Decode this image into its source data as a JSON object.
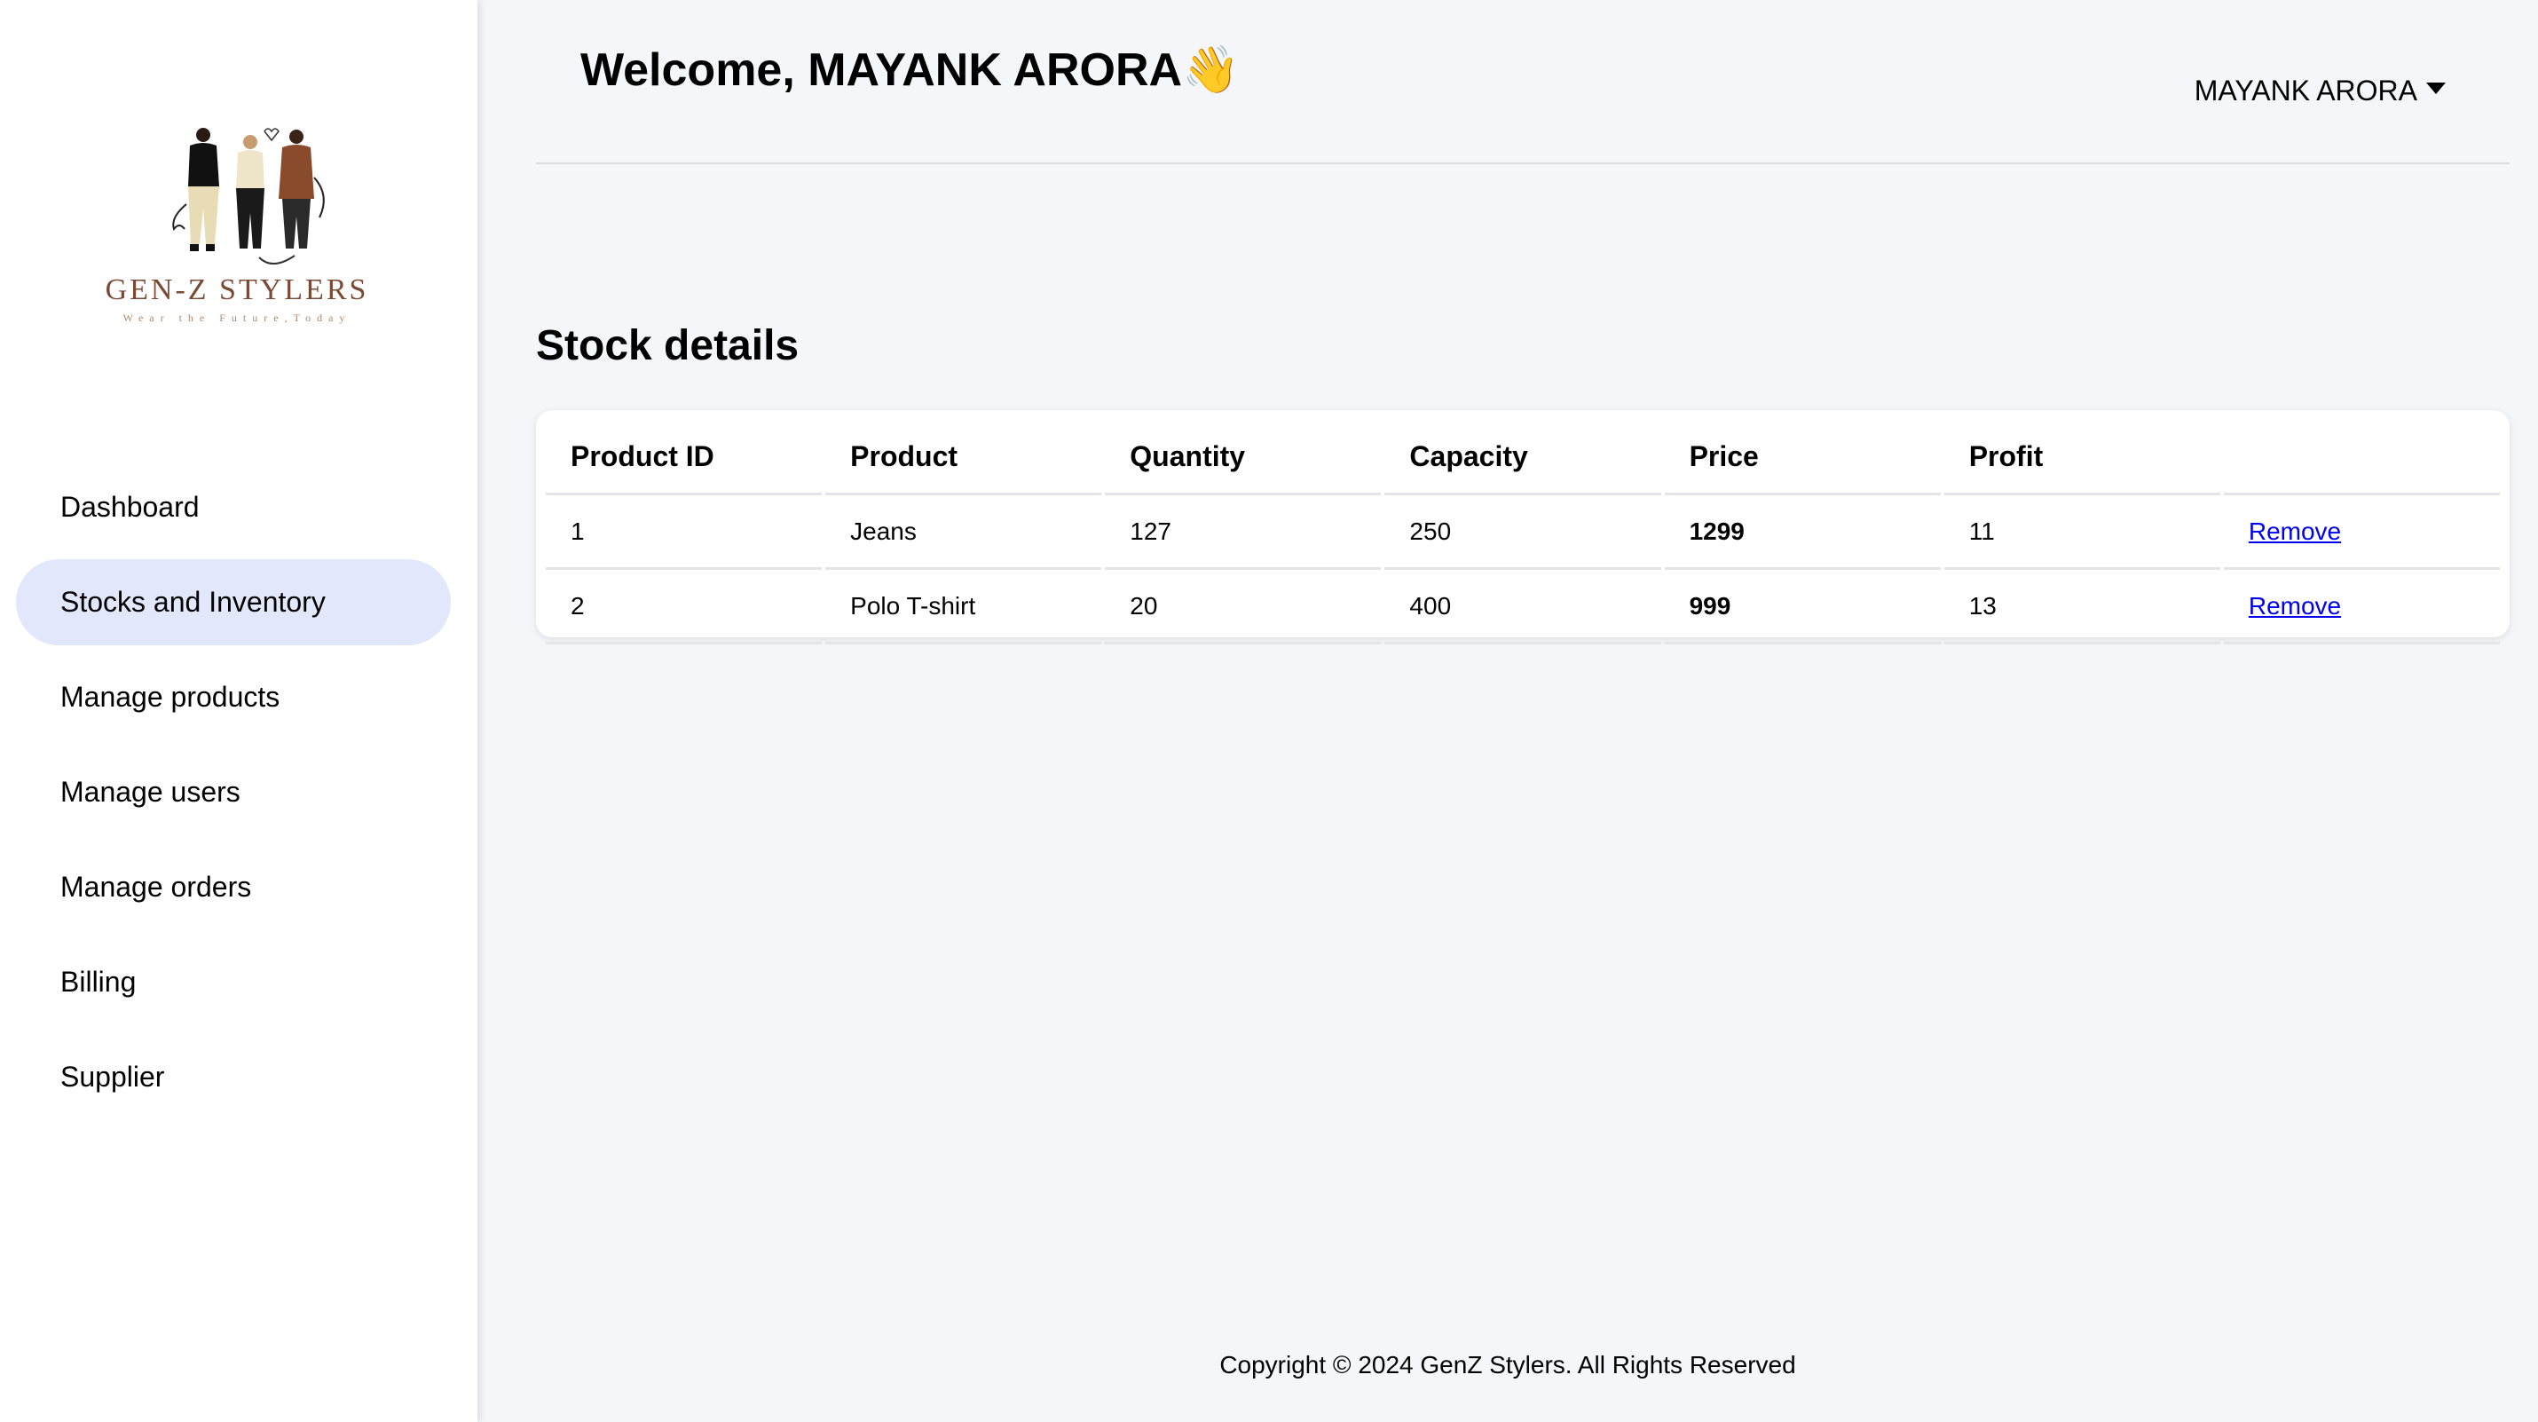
{
  "brand": {
    "name": "GEN-Z STYLERS",
    "tagline": "Wear the Future,Today"
  },
  "sidebar": {
    "items": [
      {
        "label": "Dashboard",
        "active": false
      },
      {
        "label": "Stocks and Inventory",
        "active": true
      },
      {
        "label": "Manage products",
        "active": false
      },
      {
        "label": "Manage users",
        "active": false
      },
      {
        "label": "Manage orders",
        "active": false
      },
      {
        "label": "Billing",
        "active": false
      },
      {
        "label": "Supplier",
        "active": false
      }
    ]
  },
  "header": {
    "welcome": "Welcome, MAYANK ARORA👋",
    "user_name": "MAYANK ARORA",
    "user_menu_icon": "caret-down-icon"
  },
  "stock": {
    "title": "Stock details",
    "columns": [
      "Product ID",
      "Product",
      "Quantity",
      "Capacity",
      "Price",
      "Profit",
      ""
    ],
    "rows": [
      {
        "id": "1",
        "product": "Jeans",
        "quantity": "127",
        "capacity": "250",
        "price": "1299",
        "profit": "11",
        "action": "Remove"
      },
      {
        "id": "2",
        "product": "Polo T-shirt",
        "quantity": "20",
        "capacity": "400",
        "price": "999",
        "profit": "13",
        "action": "Remove"
      }
    ]
  },
  "footer": {
    "copyright": "Copyright © 2024 GenZ Stylers. All Rights Reserved"
  },
  "colors": {
    "active_nav_bg": "#e3e7fb",
    "page_bg": "#f5f6fa",
    "link": "#0000ee",
    "brand_text": "#7a4a34"
  }
}
